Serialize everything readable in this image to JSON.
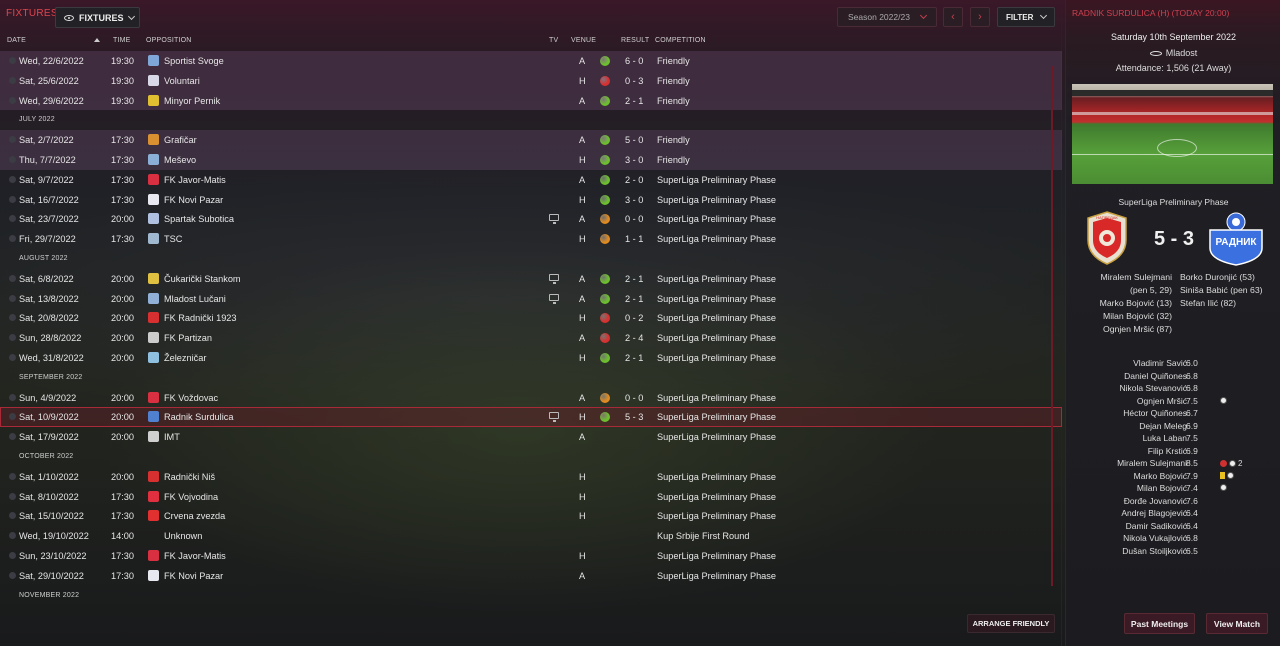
{
  "header": {
    "title": "FIXTURES",
    "view_dropdown": "FIXTURES",
    "season": "Season 2022/23",
    "filter": "FILTER",
    "prev_icon": "chevron-left-icon",
    "next_icon": "chevron-right-icon"
  },
  "columns": {
    "date": "DATE",
    "time": "TIME",
    "opposition": "OPPOSITION",
    "tv": "TV",
    "venue": "VENUE",
    "result": "RESULT",
    "competition": "COMPETITION"
  },
  "colors": {
    "win": "#6dbf2e",
    "loss": "#d83030",
    "draw": "#e08a20",
    "accent": "#e0454f"
  },
  "fixtures": [
    {
      "type": "match",
      "friendly": true,
      "date": "Wed, 22/6/2022",
      "time": "19:30",
      "opp": "Sportist Svoge",
      "crest": "#7fa8d8",
      "tv": false,
      "venue": "A",
      "outcome": "win",
      "result": "6 - 0",
      "comp": "Friendly"
    },
    {
      "type": "match",
      "friendly": true,
      "date": "Sat, 25/6/2022",
      "time": "19:30",
      "opp": "Voluntari",
      "crest": "#d8d8e8",
      "tv": false,
      "venue": "H",
      "outcome": "loss",
      "result": "0 - 3",
      "comp": "Friendly"
    },
    {
      "type": "match",
      "friendly": true,
      "date": "Wed, 29/6/2022",
      "time": "19:30",
      "opp": "Minyor Pernik",
      "crest": "#e0c030",
      "tv": false,
      "venue": "A",
      "outcome": "win",
      "result": "2 - 1",
      "comp": "Friendly"
    },
    {
      "type": "month",
      "label": "JULY 2022"
    },
    {
      "type": "match",
      "friendly": true,
      "date": "Sat, 2/7/2022",
      "time": "17:30",
      "opp": "Grafičar",
      "crest": "#d89030",
      "tv": false,
      "venue": "A",
      "outcome": "win",
      "result": "5 - 0",
      "comp": "Friendly"
    },
    {
      "type": "match",
      "friendly": true,
      "date": "Thu, 7/7/2022",
      "time": "17:30",
      "opp": "Meševo",
      "crest": "#8ab0d8",
      "tv": false,
      "venue": "H",
      "outcome": "win",
      "result": "3 - 0",
      "comp": "Friendly"
    },
    {
      "type": "match",
      "friendly": false,
      "date": "Sat, 9/7/2022",
      "time": "17:30",
      "opp": "FK Javor-Matis",
      "crest": "#d83040",
      "tv": false,
      "venue": "A",
      "outcome": "win",
      "result": "2 - 0",
      "comp": "SuperLiga Preliminary Phase"
    },
    {
      "type": "match",
      "friendly": false,
      "date": "Sat, 16/7/2022",
      "time": "17:30",
      "opp": "FK Novi Pazar",
      "crest": "#e8e8f0",
      "tv": false,
      "venue": "H",
      "outcome": "win",
      "result": "3 - 0",
      "comp": "SuperLiga Preliminary Phase"
    },
    {
      "type": "match",
      "friendly": false,
      "date": "Sat, 23/7/2022",
      "time": "20:00",
      "opp": "Spartak Subotica",
      "crest": "#b0c0e0",
      "tv": true,
      "venue": "A",
      "outcome": "draw",
      "result": "0 - 0",
      "comp": "SuperLiga Preliminary Phase"
    },
    {
      "type": "match",
      "friendly": false,
      "date": "Fri, 29/7/2022",
      "time": "17:30",
      "opp": "TSC",
      "crest": "#a0b8d0",
      "tv": false,
      "venue": "H",
      "outcome": "draw",
      "result": "1 - 1",
      "comp": "SuperLiga Preliminary Phase"
    },
    {
      "type": "month",
      "label": "AUGUST 2022"
    },
    {
      "type": "match",
      "friendly": false,
      "date": "Sat, 6/8/2022",
      "time": "20:00",
      "opp": "Čukarički Stankom",
      "crest": "#e0c040",
      "tv": true,
      "venue": "A",
      "outcome": "win",
      "result": "2 - 1",
      "comp": "SuperLiga Preliminary Phase"
    },
    {
      "type": "match",
      "friendly": false,
      "date": "Sat, 13/8/2022",
      "time": "20:00",
      "opp": "Mladost Lučani",
      "crest": "#90b0d8",
      "tv": true,
      "venue": "A",
      "outcome": "win",
      "result": "2 - 1",
      "comp": "SuperLiga Preliminary Phase"
    },
    {
      "type": "match",
      "friendly": false,
      "date": "Sat, 20/8/2022",
      "time": "20:00",
      "opp": "FK Radnički 1923",
      "crest": "#d83030",
      "tv": false,
      "venue": "H",
      "outcome": "loss",
      "result": "0 - 2",
      "comp": "SuperLiga Preliminary Phase"
    },
    {
      "type": "match",
      "friendly": false,
      "date": "Sun, 28/8/2022",
      "time": "20:00",
      "opp": "FK Partizan",
      "crest": "#cccccc",
      "tv": false,
      "venue": "A",
      "outcome": "loss",
      "result": "2 - 4",
      "comp": "SuperLiga Preliminary Phase"
    },
    {
      "type": "match",
      "friendly": false,
      "date": "Wed, 31/8/2022",
      "time": "20:00",
      "opp": "Železničar",
      "crest": "#90c0e0",
      "tv": false,
      "venue": "H",
      "outcome": "win",
      "result": "2 - 1",
      "comp": "SuperLiga Preliminary Phase"
    },
    {
      "type": "month",
      "label": "SEPTEMBER 2022"
    },
    {
      "type": "match",
      "friendly": false,
      "date": "Sun, 4/9/2022",
      "time": "20:00",
      "opp": "FK Voždovac",
      "crest": "#d83040",
      "tv": false,
      "venue": "A",
      "outcome": "draw",
      "result": "0 - 0",
      "comp": "SuperLiga Preliminary Phase"
    },
    {
      "type": "match",
      "friendly": false,
      "current": true,
      "date": "Sat, 10/9/2022",
      "time": "20:00",
      "opp": "Radnik Surdulica",
      "crest": "#5080d0",
      "tv": true,
      "venue": "H",
      "outcome": "win",
      "result": "5 - 3",
      "comp": "SuperLiga Preliminary Phase"
    },
    {
      "type": "match",
      "friendly": false,
      "date": "Sat, 17/9/2022",
      "time": "20:00",
      "opp": "IMT",
      "crest": "#d0d0d0",
      "tv": false,
      "venue": "A",
      "outcome": "",
      "result": "",
      "comp": "SuperLiga Preliminary Phase"
    },
    {
      "type": "month",
      "label": "OCTOBER 2022"
    },
    {
      "type": "match",
      "friendly": false,
      "date": "Sat, 1/10/2022",
      "time": "20:00",
      "opp": "Radnički Niš",
      "crest": "#d83030",
      "tv": false,
      "venue": "H",
      "outcome": "",
      "result": "",
      "comp": "SuperLiga Preliminary Phase"
    },
    {
      "type": "match",
      "friendly": false,
      "date": "Sat, 8/10/2022",
      "time": "17:30",
      "opp": "FK Vojvodina",
      "crest": "#e03040",
      "tv": false,
      "venue": "H",
      "outcome": "",
      "result": "",
      "comp": "SuperLiga Preliminary Phase"
    },
    {
      "type": "match",
      "friendly": false,
      "date": "Sat, 15/10/2022",
      "time": "17:30",
      "opp": "Crvena zvezda",
      "crest": "#e03030",
      "tv": false,
      "venue": "H",
      "outcome": "",
      "result": "",
      "comp": "SuperLiga Preliminary Phase"
    },
    {
      "type": "match",
      "friendly": false,
      "date": "Wed, 19/10/2022",
      "time": "14:00",
      "opp": "Unknown",
      "crest": "",
      "tv": false,
      "venue": "",
      "outcome": "",
      "result": "",
      "comp": "Kup Srbije First Round"
    },
    {
      "type": "match",
      "friendly": false,
      "date": "Sun, 23/10/2022",
      "time": "17:30",
      "opp": "FK Javor-Matis",
      "crest": "#d83040",
      "tv": false,
      "venue": "H",
      "outcome": "",
      "result": "",
      "comp": "SuperLiga Preliminary Phase"
    },
    {
      "type": "match",
      "friendly": false,
      "date": "Sat, 29/10/2022",
      "time": "17:30",
      "opp": "FK Novi Pazar",
      "crest": "#e8e8f0",
      "tv": false,
      "venue": "A",
      "outcome": "",
      "result": "",
      "comp": "SuperLiga Preliminary Phase"
    },
    {
      "type": "month",
      "label": "NOVEMBER 2022"
    }
  ],
  "arrange_button": "ARRANGE FRIENDLY",
  "match_panel": {
    "header": "RADNIK SURDULICA (H) (TODAY 20:00)",
    "date": "Saturday 10th September 2022",
    "stadium": "Mladost",
    "attendance": "Attendance: 1,506 (21 Away)",
    "competition": "SuperLiga Preliminary Phase",
    "score": "5 - 3",
    "home_badge_text": "НАПРЕДАК",
    "away_badge_text": "РАДНИК",
    "home_scorers": [
      "Miralem Sulejmani",
      "(pen 5, 29)",
      "Marko Bojović (13)",
      "Milan Bojović (32)",
      "Ognjen Mršić (87)"
    ],
    "away_scorers": [
      "Borko Duronjić (53)",
      "Siniša Babić (pen 63)",
      "Stefan Ilić (82)"
    ],
    "players": [
      {
        "name": "Vladimir Savić",
        "rating": "6.0",
        "events": []
      },
      {
        "name": "Daniel Quiñones",
        "rating": "6.8",
        "events": []
      },
      {
        "name": "Nikola Stevanović",
        "rating": "6.8",
        "events": []
      },
      {
        "name": "Ognjen Mršić",
        "rating": "7.5",
        "events": [
          "goal"
        ]
      },
      {
        "name": "Héctor Quiñones",
        "rating": "6.7",
        "events": []
      },
      {
        "name": "Dejan Meleg",
        "rating": "6.9",
        "events": []
      },
      {
        "name": "Luka Laban",
        "rating": "7.5",
        "events": []
      },
      {
        "name": "Filip Krstić",
        "rating": "6.9",
        "events": []
      },
      {
        "name": "Miralem Sulejmani",
        "rating": "8.5",
        "events": [
          "player-of-match",
          "goal"
        ],
        "goal_count": "2"
      },
      {
        "name": "Marko Bojović",
        "rating": "7.9",
        "events": [
          "yellow",
          "goal"
        ]
      },
      {
        "name": "Milan Bojović",
        "rating": "7.4",
        "events": [
          "goal"
        ]
      },
      {
        "name": "Đorđe Jovanović",
        "rating": "7.6",
        "events": []
      },
      {
        "name": "Andrej Blagojević",
        "rating": "6.4",
        "events": []
      },
      {
        "name": "Damir Sadiković",
        "rating": "6.4",
        "events": []
      },
      {
        "name": "Nikola Vukajlović",
        "rating": "6.8",
        "events": []
      },
      {
        "name": "Dušan Stoiljković",
        "rating": "6.5",
        "events": []
      }
    ],
    "past_meetings": "Past Meetings",
    "view_match": "View Match"
  }
}
